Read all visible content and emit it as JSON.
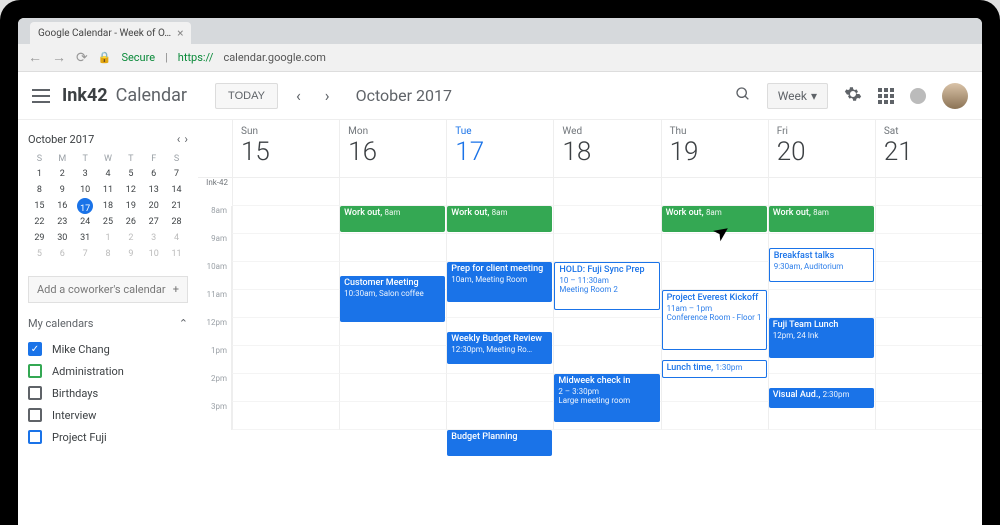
{
  "browser": {
    "tab_title": "Google Calendar - Week of O…",
    "secure_label": "Secure",
    "url_host": "https://",
    "url_domain": "calendar.google.com"
  },
  "header": {
    "brand": "Ink42",
    "product": "Calendar",
    "today": "TODAY",
    "month": "October 2017",
    "view": "Week"
  },
  "mini": {
    "title": "October 2017",
    "dow": [
      "S",
      "M",
      "T",
      "W",
      "T",
      "F",
      "S"
    ],
    "weeks": [
      [
        {
          "n": 1
        },
        {
          "n": 2
        },
        {
          "n": 3
        },
        {
          "n": 4
        },
        {
          "n": 5
        },
        {
          "n": 6
        },
        {
          "n": 7
        }
      ],
      [
        {
          "n": 8
        },
        {
          "n": 9
        },
        {
          "n": 10
        },
        {
          "n": 11
        },
        {
          "n": 12
        },
        {
          "n": 13
        },
        {
          "n": 14
        }
      ],
      [
        {
          "n": 15
        },
        {
          "n": 16
        },
        {
          "n": 17,
          "today": true
        },
        {
          "n": 18
        },
        {
          "n": 19
        },
        {
          "n": 20
        },
        {
          "n": 21
        }
      ],
      [
        {
          "n": 22
        },
        {
          "n": 23
        },
        {
          "n": 24
        },
        {
          "n": 25
        },
        {
          "n": 26
        },
        {
          "n": 27
        },
        {
          "n": 28
        }
      ],
      [
        {
          "n": 29
        },
        {
          "n": 30
        },
        {
          "n": 31
        },
        {
          "n": 1,
          "dim": true
        },
        {
          "n": 2,
          "dim": true
        },
        {
          "n": 3,
          "dim": true
        },
        {
          "n": 4,
          "dim": true
        }
      ],
      [
        {
          "n": 5,
          "dim": true
        },
        {
          "n": 6,
          "dim": true
        },
        {
          "n": 7,
          "dim": true
        },
        {
          "n": 8,
          "dim": true
        },
        {
          "n": 9,
          "dim": true
        },
        {
          "n": 10,
          "dim": true
        },
        {
          "n": 11,
          "dim": true
        }
      ]
    ]
  },
  "sidebar": {
    "add_coworker": "Add a coworker's calendar",
    "my_calendars": "My calendars",
    "cals": [
      {
        "label": "Mike Chang",
        "color": "#1a73e8",
        "checked": true
      },
      {
        "label": "Administration",
        "color": "#34a853",
        "checked": false
      },
      {
        "label": "Birthdays",
        "color": "#5f6368",
        "checked": false
      },
      {
        "label": "Interview",
        "color": "#5f6368",
        "checked": false
      },
      {
        "label": "Project Fuji",
        "color": "#1a73e8",
        "checked": false
      }
    ]
  },
  "days": [
    {
      "dow": "Sun",
      "num": "15"
    },
    {
      "dow": "Mon",
      "num": "16"
    },
    {
      "dow": "Tue",
      "num": "17",
      "active": true
    },
    {
      "dow": "Wed",
      "num": "18"
    },
    {
      "dow": "Thu",
      "num": "19"
    },
    {
      "dow": "Fri",
      "num": "20"
    },
    {
      "dow": "Sat",
      "num": "21"
    }
  ],
  "row_label": "Ink-42",
  "hours": [
    "8am",
    "9am",
    "10am",
    "11am",
    "12pm",
    "1pm",
    "2pm",
    "3pm"
  ],
  "events": [
    {
      "day": 1,
      "row": 0,
      "span": 1,
      "title": "Work out",
      "sub": "8am",
      "color": "#34a853"
    },
    {
      "day": 2,
      "row": 0,
      "span": 1,
      "title": "Work out",
      "sub": "8am",
      "color": "#34a853"
    },
    {
      "day": 4,
      "row": 0,
      "span": 1,
      "title": "Work out",
      "sub": "8am",
      "color": "#34a853"
    },
    {
      "day": 5,
      "row": 0,
      "span": 1,
      "title": "Work out",
      "sub": "8am",
      "color": "#34a853"
    },
    {
      "day": 5,
      "row": 1.5,
      "span": 1.3,
      "title": "Breakfast talks",
      "sub": "9:30am, Auditorium",
      "color": "#1a73e8",
      "outline": true
    },
    {
      "day": 2,
      "row": 2,
      "span": 1.5,
      "title": "Prep for client meeting",
      "sub": "10am, Meeting Room",
      "color": "#1a73e8"
    },
    {
      "day": 3,
      "row": 2,
      "span": 1.8,
      "title": "HOLD: Fuji Sync Prep",
      "sub": "10 – 11:30am\nMeeting Room 2",
      "color": "#1a73e8",
      "outline": true
    },
    {
      "day": 1,
      "row": 2.5,
      "span": 1.7,
      "title": "Customer Meeting",
      "sub": "10:30am, Salon coffee",
      "color": "#1a73e8"
    },
    {
      "day": 4,
      "row": 3,
      "span": 2.2,
      "title": "Project Everest Kickoff",
      "sub": "11am – 1pm\nConference Room - Floor 1",
      "color": "#1a73e8",
      "outline": true
    },
    {
      "day": 5,
      "row": 4,
      "span": 1.5,
      "title": "Fuji Team Lunch",
      "sub": "12pm, 24 Ink",
      "color": "#1a73e8"
    },
    {
      "day": 2,
      "row": 4.5,
      "span": 1.2,
      "title": "Weekly Budget Review",
      "sub": "12:30pm, Meeting Ro…",
      "color": "#1a73e8"
    },
    {
      "day": 4,
      "row": 5.5,
      "span": 0.7,
      "title": "Lunch time",
      "sub": "1:30pm",
      "color": "#1a73e8",
      "outline": true,
      "inline": true
    },
    {
      "day": 3,
      "row": 6,
      "span": 1.8,
      "title": "Midweek check in",
      "sub": "2 – 3:30pm\nLarge meeting room",
      "color": "#1a73e8"
    },
    {
      "day": 5,
      "row": 6.5,
      "span": 0.8,
      "title": "Visual Aud.",
      "sub": "2:30pm",
      "color": "#1a73e8",
      "inline": true
    },
    {
      "day": 2,
      "row": 8,
      "span": 1,
      "title": "Budget Planning",
      "sub": "",
      "color": "#1a73e8"
    }
  ]
}
